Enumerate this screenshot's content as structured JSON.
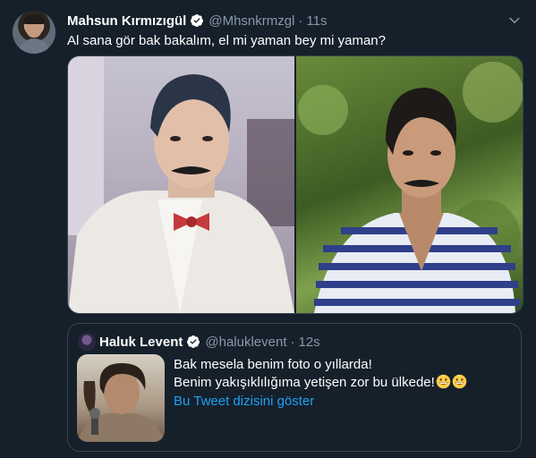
{
  "tweet": {
    "author_name": "Mahsun Kırmızıgül",
    "handle": "@Mhsnkrmzgl",
    "separator": "·",
    "time": "11s",
    "text": "Al sana gör bak bakalım, el mi yaman bey mi yaman?"
  },
  "quote": {
    "author_name": "Haluk Levent",
    "handle": "@haluklevent",
    "separator": "·",
    "time": "12s",
    "line1": "Bak mesela benim foto o yıllarda!",
    "line2": "Benim yakışıklılığıma yetişen zor bu ülkede!",
    "show_thread": "Bu Tweet dizisini göster"
  },
  "colors": {
    "background": "#15202b",
    "text_primary": "#ffffff",
    "text_secondary": "#8899a6",
    "accent": "#1da1f2",
    "border": "#38444d"
  },
  "icons": [
    "verified-badge-icon",
    "chevron-down-icon",
    "grinning-emoji-icon"
  ]
}
